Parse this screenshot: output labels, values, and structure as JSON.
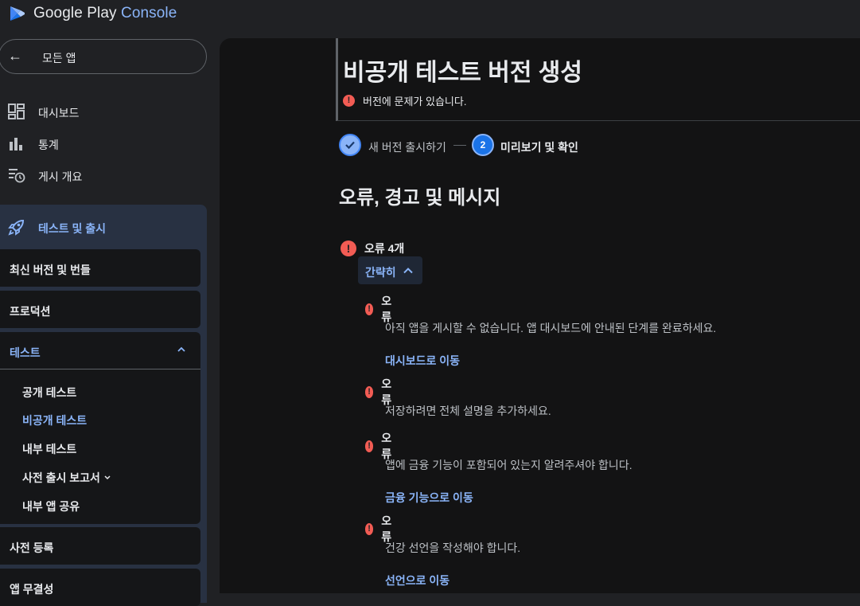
{
  "app": {
    "logo_text_primary": "Google Play",
    "logo_text_accent": "Console",
    "logo_icon": "google-play-console-logo"
  },
  "sidebar": {
    "back_label": "모든 앱",
    "items": [
      {
        "label": "대시보드",
        "icon": "dashboard-icon"
      },
      {
        "label": "통계",
        "icon": "bar-chart-icon"
      },
      {
        "label": "게시 개요",
        "icon": "publishing-overview-icon"
      }
    ],
    "release_group": {
      "label": "테스트 및 출시",
      "icon": "rocket-icon",
      "cards": [
        {
          "label": "최신 버전 및 번들"
        },
        {
          "label": "프로덕션"
        },
        {
          "label": "테스트",
          "expanded": true,
          "sub_items": [
            {
              "label": "공개 테스트"
            },
            {
              "label": "비공개 테스트",
              "active": true
            },
            {
              "label": "내부 테스트"
            },
            {
              "label": "사전 출시 보고서"
            },
            {
              "label": "내부 앱 공유"
            }
          ]
        },
        {
          "label": "사전 등록"
        },
        {
          "label": "앱 무결성"
        }
      ]
    }
  },
  "main": {
    "page_title": "비공개 테스트 버전 생성",
    "title_error": "버전에 문제가 있습니다.",
    "stepper": {
      "step1_label": "새 버전 출시하기",
      "step2_number": "2",
      "step2_label": "미리보기 및 확인"
    },
    "section_title": "오류, 경고 및 메시지",
    "error_count": "오류 4개",
    "collapse_label": "간략히",
    "errors": [
      {
        "label": "오류",
        "desc": "아직 앱을 게시할 수 없습니다. 앱 대시보드에 안내된 단계를 완료하세요.",
        "link": "대시보드로 이동"
      },
      {
        "label": "오류",
        "desc": "저장하려면 전체 설명을 추가하세요.",
        "link": ""
      },
      {
        "label": "오류",
        "desc": "앱에 금융 기능이 포함되어 있는지 알려주셔야 합니다.",
        "link": "금융 기능으로 이동"
      },
      {
        "label": "오류",
        "desc": "건강 선언을 작성해야 합니다.",
        "link": "선언으로 이동"
      }
    ]
  },
  "colors": {
    "accent": "#8ab4f8",
    "error": "#f25c54",
    "background": "#202124",
    "panel": "#131314"
  }
}
